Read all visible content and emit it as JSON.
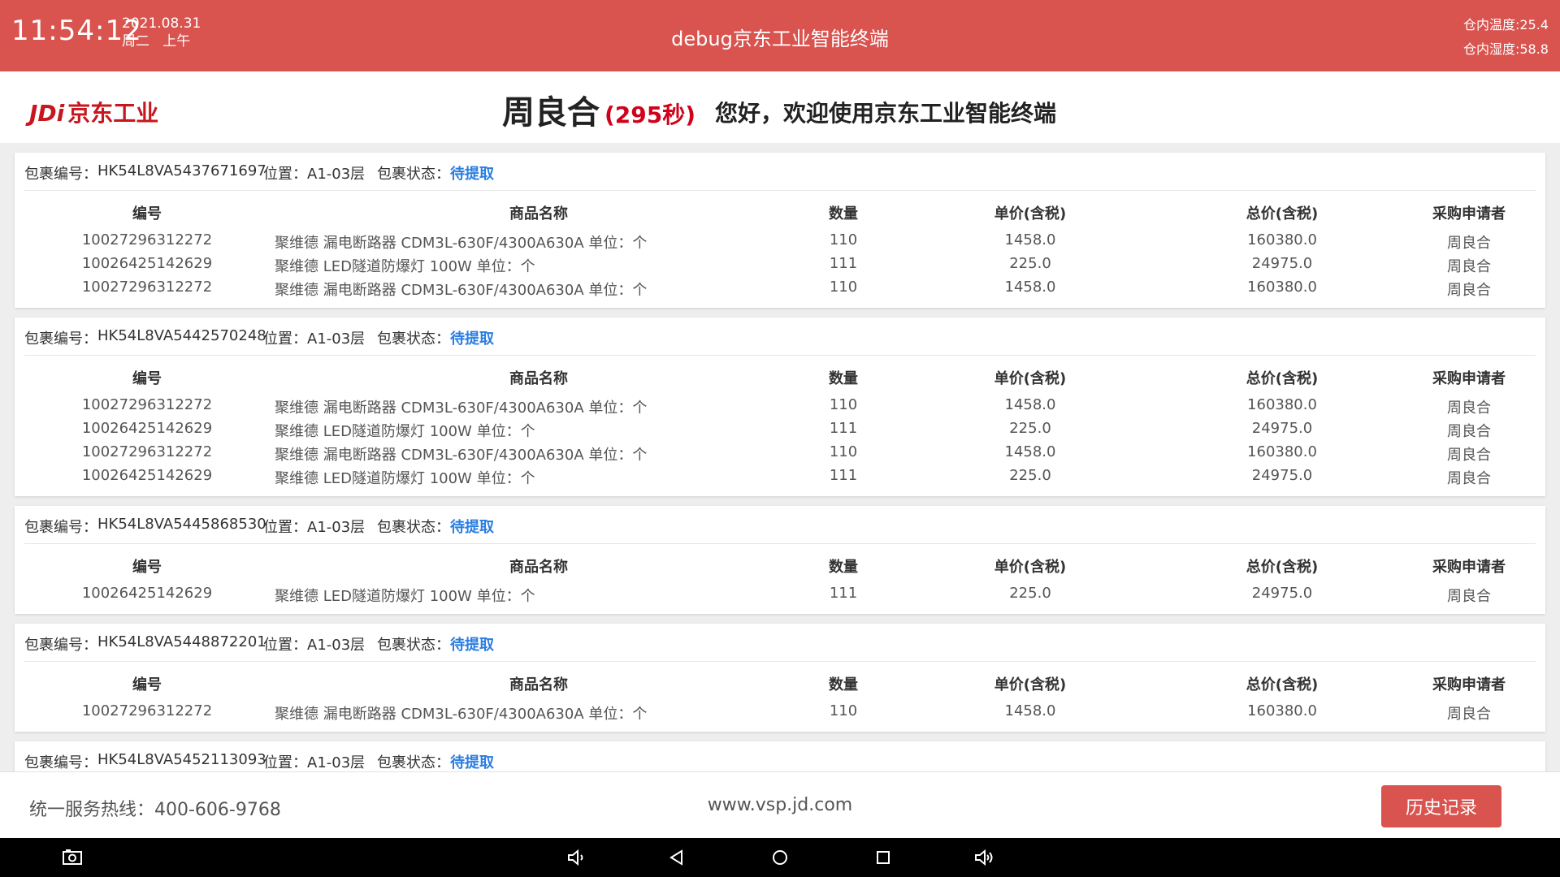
{
  "status_bar": {
    "time": "11:54:12",
    "date": "2021.08.31",
    "weekday": "周二",
    "period": "上午",
    "app_title": "debug京东工业智能终端",
    "temperature": "仓内温度:25.4",
    "humidity": "仓内湿度:58.8"
  },
  "header": {
    "logo_mark": "JDi",
    "logo_text": "京东工业",
    "user_name": "周良合",
    "countdown": "(295秒)",
    "welcome": "您好，欢迎使用京东工业智能终端"
  },
  "labels": {
    "package_no": "包裹编号：",
    "location": "位置：",
    "package_status": "包裹状态："
  },
  "columns": [
    "编号",
    "商品名称",
    "数量",
    "单价(含税)",
    "总价(含税)",
    "采购申请者"
  ],
  "packages": [
    {
      "id": "HK54L8VA5437671697",
      "location": "A1-03层",
      "status": "待提取",
      "items": [
        {
          "code": "10027296312272",
          "name": "聚维德 漏电断路器 CDM3L-630F/4300A630A 单位：个",
          "qty": "110",
          "unit_price": "1458.0",
          "total": "160380.0",
          "buyer": "周良合"
        },
        {
          "code": "10026425142629",
          "name": "聚维德 LED隧道防爆灯 100W 单位：个",
          "qty": "111",
          "unit_price": "225.0",
          "total": "24975.0",
          "buyer": "周良合"
        },
        {
          "code": "10027296312272",
          "name": "聚维德 漏电断路器 CDM3L-630F/4300A630A 单位：个",
          "qty": "110",
          "unit_price": "1458.0",
          "total": "160380.0",
          "buyer": "周良合"
        }
      ]
    },
    {
      "id": "HK54L8VA5442570248",
      "location": "A1-03层",
      "status": "待提取",
      "items": [
        {
          "code": "10027296312272",
          "name": "聚维德 漏电断路器 CDM3L-630F/4300A630A 单位：个",
          "qty": "110",
          "unit_price": "1458.0",
          "total": "160380.0",
          "buyer": "周良合"
        },
        {
          "code": "10026425142629",
          "name": "聚维德 LED隧道防爆灯 100W 单位：个",
          "qty": "111",
          "unit_price": "225.0",
          "total": "24975.0",
          "buyer": "周良合"
        },
        {
          "code": "10027296312272",
          "name": "聚维德 漏电断路器 CDM3L-630F/4300A630A 单位：个",
          "qty": "110",
          "unit_price": "1458.0",
          "total": "160380.0",
          "buyer": "周良合"
        },
        {
          "code": "10026425142629",
          "name": "聚维德 LED隧道防爆灯 100W 单位：个",
          "qty": "111",
          "unit_price": "225.0",
          "total": "24975.0",
          "buyer": "周良合"
        }
      ]
    },
    {
      "id": "HK54L8VA5445868530",
      "location": "A1-03层",
      "status": "待提取",
      "items": [
        {
          "code": "10026425142629",
          "name": "聚维德 LED隧道防爆灯 100W 单位：个",
          "qty": "111",
          "unit_price": "225.0",
          "total": "24975.0",
          "buyer": "周良合"
        }
      ]
    },
    {
      "id": "HK54L8VA5448872201",
      "location": "A1-03层",
      "status": "待提取",
      "items": [
        {
          "code": "10027296312272",
          "name": "聚维德 漏电断路器 CDM3L-630F/4300A630A 单位：个",
          "qty": "110",
          "unit_price": "1458.0",
          "total": "160380.0",
          "buyer": "周良合"
        }
      ]
    },
    {
      "id": "HK54L8VA5452113093",
      "location": "A1-03层",
      "status": "待提取",
      "items": []
    }
  ],
  "footer": {
    "hotline": "统一服务热线：400-606-9768",
    "website": "www.vsp.jd.com",
    "history_button": "历史记录"
  },
  "nav_icons": [
    "screenshot-icon",
    "volume-down-icon",
    "back-icon",
    "home-icon",
    "recents-icon",
    "volume-up-icon"
  ],
  "colors": {
    "brand_red": "#d9534f",
    "status_blue": "#2a7de1",
    "countdown_red": "#d0021b"
  }
}
